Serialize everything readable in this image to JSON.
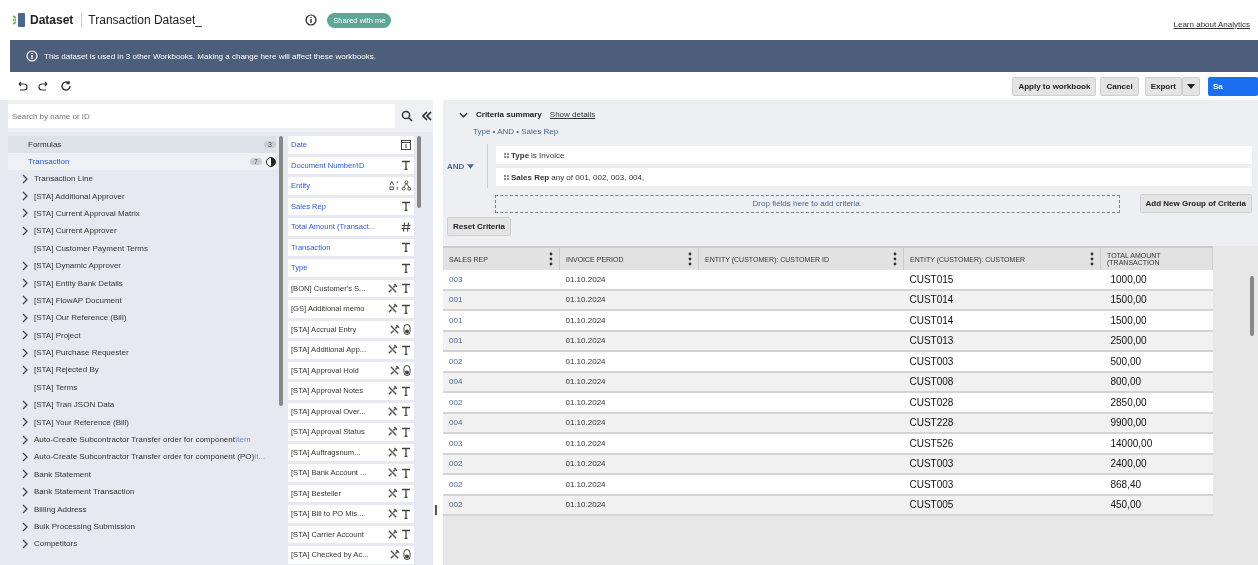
{
  "header": {
    "app_name": "Dataset",
    "dataset_title": "Transaction Dataset_",
    "badge": "Shared with me",
    "help_link": "Learn about Analytics"
  },
  "banner": {
    "message": "This dataset is used in 3 other Workbooks. Making a change here will affect these workbooks."
  },
  "toolbar": {
    "buttons": [
      "Apply to workbook",
      "Cancel",
      "Export"
    ],
    "primary_button": "Sa"
  },
  "search": {
    "placeholder": "Search by name or ID"
  },
  "record_types": [
    {
      "label": "Formulas",
      "count": "3",
      "selected": false
    },
    {
      "label": "Transaction",
      "count": "7",
      "selected": true
    }
  ],
  "tree": [
    {
      "label": "Transaction Line",
      "expandable": true
    },
    {
      "label": "[STA] Additional Approver",
      "expandable": true
    },
    {
      "label": "[STA] Current Approval Matrix",
      "expandable": true
    },
    {
      "label": "[STA] Current Approver",
      "expandable": true
    },
    {
      "label": "[STA] Customer Payment Terms",
      "expandable": false
    },
    {
      "label": "[STA] Dynamic Approver",
      "expandable": true
    },
    {
      "label": "[STA] Entity Bank Details",
      "expandable": true
    },
    {
      "label": "[STA] FlowAP Document",
      "expandable": true
    },
    {
      "label": "[STA] Our Reference (Bill)",
      "expandable": true
    },
    {
      "label": "[STA] Project",
      "expandable": true
    },
    {
      "label": "[STA] Purchase Requester",
      "expandable": true
    },
    {
      "label": "[STA] Rejected By",
      "expandable": true
    },
    {
      "label": "[STA] Terms",
      "expandable": false
    },
    {
      "label": "[STA] Tran JSON Data",
      "expandable": true
    },
    {
      "label": "[STA] Your Reference (Bill)",
      "expandable": true
    },
    {
      "label": "Auto-Create Subcontractor Transfer order for component",
      "suffix": "Item",
      "expandable": true
    },
    {
      "label": "Auto-Create Subcontractor Transfer order for component (PO)",
      "suffix": "It...",
      "expandable": true
    },
    {
      "label": "Bank Statement",
      "expandable": true
    },
    {
      "label": "Bank Statement Transaction",
      "expandable": true
    },
    {
      "label": "Billing Address",
      "expandable": true
    },
    {
      "label": "Bulk Processing Submission",
      "expandable": true
    },
    {
      "label": "Competitors",
      "expandable": true
    }
  ],
  "fields": [
    {
      "label": "Date",
      "used": true,
      "custom": false,
      "kind": "date"
    },
    {
      "label": "Document Number/ID",
      "used": true,
      "custom": false,
      "kind": "text"
    },
    {
      "label": "Entity",
      "used": true,
      "custom": false,
      "kind": "entity"
    },
    {
      "label": "Sales Rep",
      "used": true,
      "custom": false,
      "kind": "text"
    },
    {
      "label": "Total Amount (Transact...",
      "used": true,
      "custom": false,
      "kind": "number"
    },
    {
      "label": "Transaction",
      "used": true,
      "custom": false,
      "kind": "text"
    },
    {
      "label": "Type",
      "used": true,
      "custom": false,
      "kind": "text"
    },
    {
      "label": "[BON] Customer's S...",
      "used": false,
      "custom": true,
      "kind": "text"
    },
    {
      "label": "[GS] Additional memo",
      "used": false,
      "custom": true,
      "kind": "text"
    },
    {
      "label": "[STA] Accrual Entry",
      "used": false,
      "custom": true,
      "kind": "boolean"
    },
    {
      "label": "[STA] Additional App...",
      "used": false,
      "custom": true,
      "kind": "text"
    },
    {
      "label": "[STA] Approval Hold",
      "used": false,
      "custom": true,
      "kind": "boolean"
    },
    {
      "label": "[STA] Approval Notes",
      "used": false,
      "custom": true,
      "kind": "text"
    },
    {
      "label": "[STA] Approval Over...",
      "used": false,
      "custom": true,
      "kind": "text"
    },
    {
      "label": "[STA] Approval Status",
      "used": false,
      "custom": true,
      "kind": "text"
    },
    {
      "label": "[STA] Auftragsnum...",
      "used": false,
      "custom": true,
      "kind": "text"
    },
    {
      "label": "[STA] Bank Account ...",
      "used": false,
      "custom": true,
      "kind": "text"
    },
    {
      "label": "[STA] Besteller",
      "used": false,
      "custom": true,
      "kind": "text"
    },
    {
      "label": "[STA] Bill to PO Mis...",
      "used": false,
      "custom": true,
      "kind": "text"
    },
    {
      "label": "[STA] Carrier Account",
      "used": false,
      "custom": true,
      "kind": "text"
    },
    {
      "label": "[STA] Checked by Ac...",
      "used": false,
      "custom": true,
      "kind": "boolean"
    }
  ],
  "criteria": {
    "title": "Criteria summary",
    "details_link": "Show details",
    "summary": "Type • AND • Sales Rep",
    "operator": "AND",
    "conditions": [
      {
        "field": "Type",
        "rest": "is Invoice"
      },
      {
        "field": "Sales Rep",
        "rest": "any of 001, 002, 003, 004,"
      }
    ],
    "drop_hint": "Drop fields here to add criteria.",
    "add_group": "Add New Group of Criteria",
    "reset": "Reset Criteria"
  },
  "table": {
    "columns": [
      "SALES REP",
      "INVOICE PERIOD",
      "ENTITY (CUSTOMER): CUSTOMER ID",
      "ENTITY (CUSTOMER): CUSTOMER",
      "TOTAL AMOUNT (TRANSACTION"
    ],
    "rows": [
      [
        "003",
        "01.10.2024",
        "",
        "CUST015",
        "1000,00"
      ],
      [
        "001",
        "01.10.2024",
        "",
        "CUST014",
        "1500,00"
      ],
      [
        "001",
        "01.10.2024",
        "",
        "CUST014",
        "1500,00"
      ],
      [
        "001",
        "01.10.2024",
        "",
        "CUST013",
        "2500,00"
      ],
      [
        "002",
        "01.10.2024",
        "",
        "CUST003",
        "500,00"
      ],
      [
        "004",
        "01.10.2024",
        "",
        "CUST008",
        "800,00"
      ],
      [
        "002",
        "01.10.2024",
        "",
        "CUST028",
        "2850,00"
      ],
      [
        "004",
        "01.10.2024",
        "",
        "CUST228",
        "9900,00"
      ],
      [
        "003",
        "01.10.2024",
        "",
        "CUST526",
        "14000,00"
      ],
      [
        "002",
        "01.10.2024",
        "",
        "CUST003",
        "2400,00"
      ],
      [
        "002",
        "01.10.2024",
        "",
        "CUST003",
        "868,40"
      ],
      [
        "002",
        "01.10.2024",
        "",
        "CUST005",
        "450,00"
      ]
    ]
  }
}
